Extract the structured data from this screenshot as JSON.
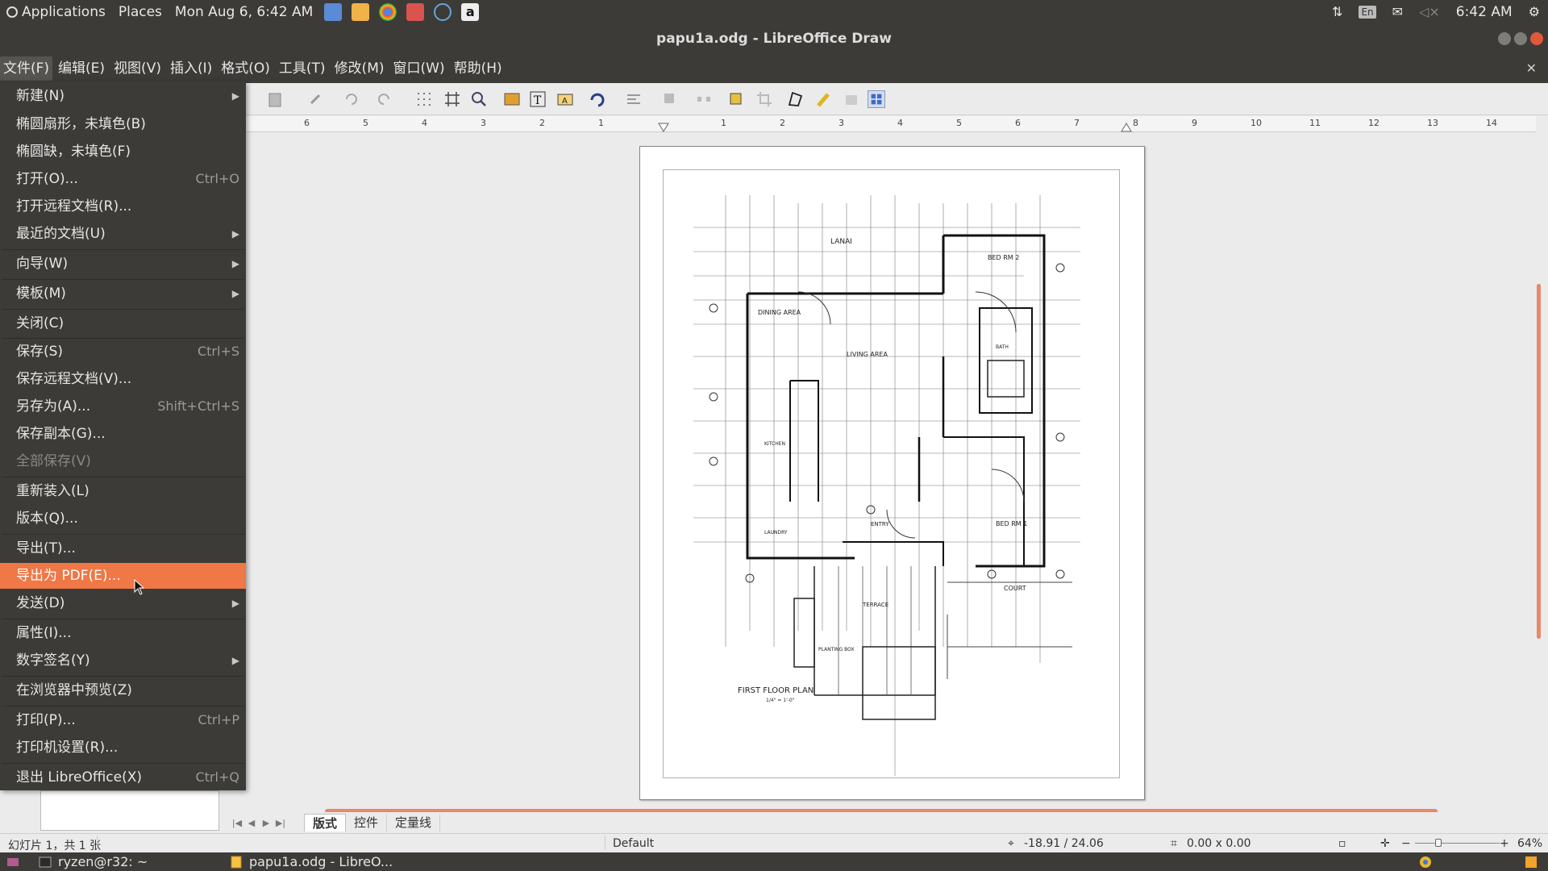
{
  "top_panel": {
    "applications": "Applications",
    "places": "Places",
    "datetime": "Mon Aug  6,  6:42 AM",
    "keyboard": "En",
    "clock": "6:42 AM"
  },
  "window": {
    "title": "papu1a.odg - LibreOffice Draw"
  },
  "menubar": {
    "items": [
      "文件(F)",
      "编辑(E)",
      "视图(V)",
      "插入(I)",
      "格式(O)",
      "工具(T)",
      "修改(M)",
      "窗口(W)",
      "帮助(H)"
    ]
  },
  "file_menu": {
    "items": [
      {
        "label": "新建(N)",
        "shortcut": "",
        "submenu": true
      },
      {
        "label": "椭圆扇形，未填色(B)",
        "shortcut": ""
      },
      {
        "label": "椭圆缺，未填色(F)",
        "shortcut": ""
      },
      {
        "label": "打开(O)...",
        "shortcut": "Ctrl+O"
      },
      {
        "label": "打开远程文档(R)...",
        "shortcut": ""
      },
      {
        "label": "最近的文档(U)",
        "shortcut": "",
        "submenu": true
      },
      {
        "label": "向导(W)",
        "shortcut": "",
        "submenu": true
      },
      {
        "label": "模板(M)",
        "shortcut": "",
        "submenu": true
      },
      {
        "label": "关闭(C)",
        "shortcut": ""
      },
      {
        "label": "保存(S)",
        "shortcut": "Ctrl+S"
      },
      {
        "label": "保存远程文档(V)...",
        "shortcut": ""
      },
      {
        "label": "另存为(A)...",
        "shortcut": "Shift+Ctrl+S"
      },
      {
        "label": "保存副本(G)...",
        "shortcut": ""
      },
      {
        "label": "全部保存(V)",
        "shortcut": "",
        "disabled": true
      },
      {
        "label": "重新装入(L)",
        "shortcut": ""
      },
      {
        "label": "版本(Q)...",
        "shortcut": ""
      },
      {
        "label": "导出(T)...",
        "shortcut": ""
      },
      {
        "label": "导出为 PDF(E)...",
        "shortcut": "",
        "highlighted": true
      },
      {
        "label": "发送(D)",
        "shortcut": "",
        "submenu": true
      },
      {
        "label": "属性(I)...",
        "shortcut": ""
      },
      {
        "label": "数字签名(Y)",
        "shortcut": "",
        "submenu": true
      },
      {
        "label": "在浏览器中预览(Z)",
        "shortcut": ""
      },
      {
        "label": "打印(P)...",
        "shortcut": "Ctrl+P"
      },
      {
        "label": "打印机设置(R)...",
        "shortcut": ""
      },
      {
        "label": "退出 LibreOffice(X)",
        "shortcut": "Ctrl+Q"
      }
    ]
  },
  "ruler": {
    "numbers": [
      "6",
      "5",
      "4",
      "3",
      "2",
      "1",
      "1",
      "2",
      "3",
      "4",
      "5",
      "6",
      "7",
      "8",
      "9",
      "10",
      "11",
      "12",
      "13",
      "14"
    ]
  },
  "document": {
    "drawing_labels": {
      "lanai": "LANAI",
      "dining": "DINING AREA",
      "living": "LIVING AREA",
      "kitchen": "KITCHEN",
      "laundry": "LAUNDRY",
      "bedrm2": "BED RM 2",
      "bedrm1": "BED RM 1",
      "bath": "BATH",
      "entry": "ENTRY",
      "terrace": "TERRACE",
      "court": "COURT",
      "planting": "PLANTING BOX",
      "title": "FIRST FLOOR PLAN",
      "scale": "1/4\" = 1'-0\""
    }
  },
  "tabs": {
    "items": [
      "版式",
      "控件",
      "定量线"
    ]
  },
  "status": {
    "slide": "幻灯片 1，共 1 张",
    "layout": "Default",
    "position": "-18.91 / 24.06",
    "size": "0.00 x 0.00",
    "zoom": "64%"
  },
  "taskbar": {
    "terminal": "ryzen@r32: ~",
    "app": "papu1a.odg - LibreO..."
  },
  "colors": {
    "panel": "#3c3b37",
    "accent": "#f07746",
    "canvas": "#ebebeb"
  }
}
